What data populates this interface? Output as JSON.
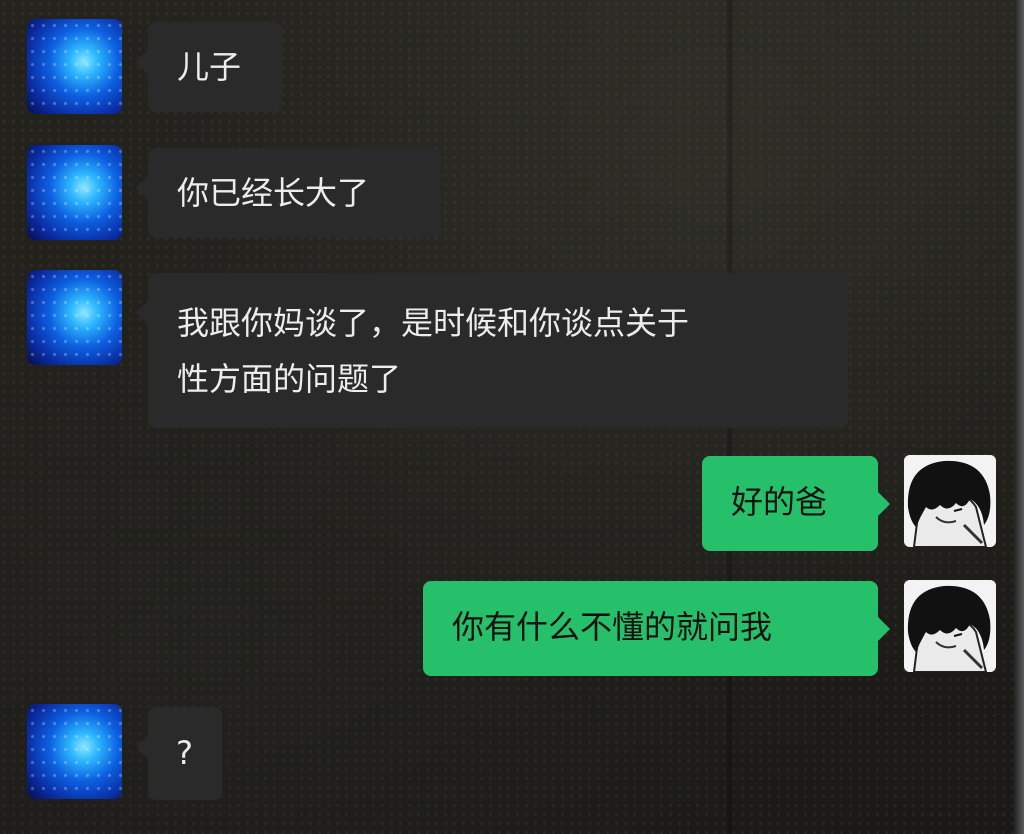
{
  "chat": {
    "messages": [
      {
        "sender": "other",
        "text": "儿子"
      },
      {
        "sender": "other",
        "text": "你已经长大了"
      },
      {
        "sender": "other",
        "line1": "我跟你妈谈了，是时候和你谈点关于",
        "line2": "性方面的问题了"
      },
      {
        "sender": "me",
        "text": "好的爸"
      },
      {
        "sender": "me",
        "text": "你有什么不懂的就问我"
      },
      {
        "sender": "other",
        "text": "?"
      }
    ]
  },
  "colors": {
    "incoming_bubble": "#2a2a2a",
    "outgoing_bubble": "#27c06a",
    "incoming_text": "#ededed",
    "outgoing_text": "#111111"
  },
  "icons": {
    "other_avatar": "blue-sparkle-avatar",
    "my_avatar": "anime-boy-avatar"
  }
}
